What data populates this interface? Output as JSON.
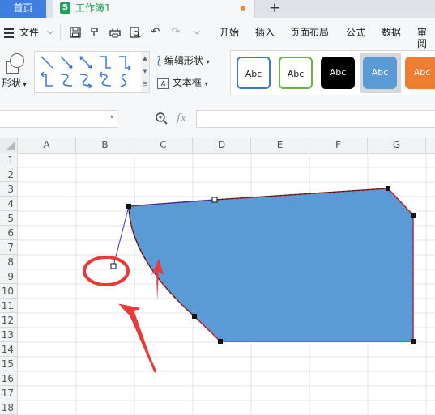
{
  "tabs": {
    "home": "首页",
    "document": "工作簿1",
    "doc_icon": "S",
    "add": "+"
  },
  "menu": {
    "file": "文件",
    "items": [
      "开始",
      "插入",
      "页面布局",
      "公式",
      "数据",
      "审阅"
    ]
  },
  "ribbon": {
    "shape_label": "形状",
    "edit_shape": "编辑形状",
    "text_box": "文本框",
    "style_label": "Abc"
  },
  "formula_bar": {
    "fx": "fx"
  },
  "columns": [
    "A",
    "B",
    "C",
    "D",
    "E",
    "F",
    "G"
  ],
  "rows": [
    "1",
    "2",
    "3",
    "4",
    "5",
    "6",
    "7",
    "8",
    "9",
    "10",
    "11",
    "12",
    "13",
    "14",
    "15",
    "16",
    "17",
    "18"
  ],
  "colors": {
    "accent_blue": "#3f7fe0",
    "shape_fill": "#5b9bd5",
    "shape_outline": "#c0202a",
    "annotation_red": "#e83a3a",
    "tab_green": "#1fa35c"
  }
}
